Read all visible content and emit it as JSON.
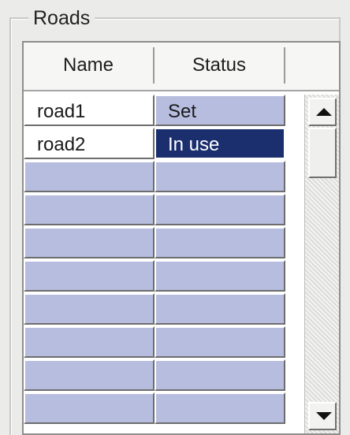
{
  "groupbox": {
    "title": "Roads"
  },
  "table": {
    "columns": [
      "Name",
      "Status"
    ],
    "rows": [
      {
        "name": "road1",
        "status": "Set",
        "selected": false
      },
      {
        "name": "road2",
        "status": "In use",
        "selected": true
      },
      {
        "name": "",
        "status": "",
        "selected": false
      },
      {
        "name": "",
        "status": "",
        "selected": false
      },
      {
        "name": "",
        "status": "",
        "selected": false
      },
      {
        "name": "",
        "status": "",
        "selected": false
      },
      {
        "name": "",
        "status": "",
        "selected": false
      },
      {
        "name": "",
        "status": "",
        "selected": false
      },
      {
        "name": "",
        "status": "",
        "selected": false
      },
      {
        "name": "",
        "status": "",
        "selected": false
      }
    ]
  },
  "scrollbar": {
    "up_icon": "scroll-up-arrow-icon",
    "down_icon": "scroll-down-arrow-icon"
  },
  "colors": {
    "window_bg": "#ebebea",
    "grid_bg": "#ffffff",
    "cell_fill": "#b7bddf",
    "selection": "#1b2f6e"
  }
}
